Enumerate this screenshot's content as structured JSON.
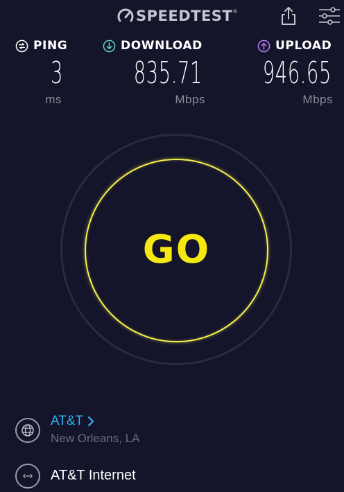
{
  "app": {
    "logo_text": "SPEEDTEST",
    "logo_mark": "®"
  },
  "header": {
    "share_icon": "share-icon",
    "settings_icon": "settings-sliders-icon"
  },
  "metrics": {
    "ping": {
      "label": "PING",
      "value": "3",
      "unit": "ms",
      "icon": "ping-icon",
      "color": "#ffffff"
    },
    "download": {
      "label": "DOWNLOAD",
      "value": "835.71",
      "unit": "Mbps",
      "icon": "download-arrow-icon",
      "color": "#5fd3c6"
    },
    "upload": {
      "label": "UPLOAD",
      "value": "946.65",
      "unit": "Mbps",
      "icon": "upload-arrow-icon",
      "color": "#b57cf5"
    }
  },
  "go": {
    "label": "GO",
    "ring_color": "#f4ef4c",
    "text_color": "#f6e912"
  },
  "server": {
    "name": "AT&T",
    "location": "New Orleans, LA",
    "icon": "globe-icon",
    "link_color": "#2fb3f0"
  },
  "isp": {
    "name": "AT&T Internet",
    "icon": "connection-dots-icon"
  }
}
